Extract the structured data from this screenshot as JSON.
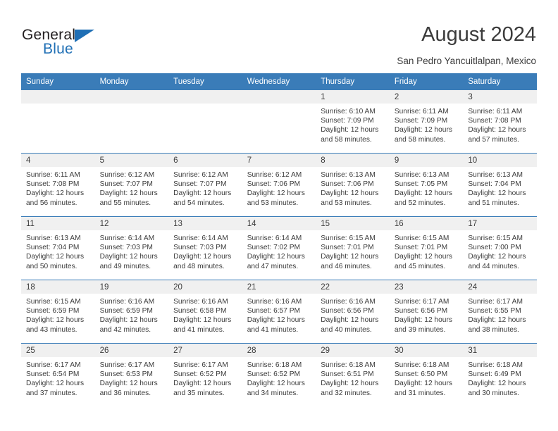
{
  "brand": {
    "word_one": "General",
    "word_two": "Blue",
    "logo_icon": "triangle-icon",
    "accent_color": "#1f6fb5"
  },
  "header": {
    "title": "August 2024",
    "subtitle": "San Pedro Yancuitlalpan, Mexico"
  },
  "theme": {
    "header_blue": "#3a7cb8",
    "daynum_gray": "#f0f0f0",
    "text": "#3b3b3b"
  },
  "calendar": {
    "weekday_headers": [
      "Sunday",
      "Monday",
      "Tuesday",
      "Wednesday",
      "Thursday",
      "Friday",
      "Saturday"
    ],
    "labels": {
      "sunrise": "Sunrise:",
      "sunset": "Sunset:",
      "daylight": "Daylight:"
    },
    "weeks": [
      [
        {
          "day": "",
          "blank": true
        },
        {
          "day": "",
          "blank": true
        },
        {
          "day": "",
          "blank": true
        },
        {
          "day": "",
          "blank": true
        },
        {
          "day": "1",
          "sunrise": "Sunrise: 6:10 AM",
          "sunset": "Sunset: 7:09 PM",
          "daylight": "Daylight: 12 hours and 58 minutes."
        },
        {
          "day": "2",
          "sunrise": "Sunrise: 6:11 AM",
          "sunset": "Sunset: 7:09 PM",
          "daylight": "Daylight: 12 hours and 58 minutes."
        },
        {
          "day": "3",
          "sunrise": "Sunrise: 6:11 AM",
          "sunset": "Sunset: 7:08 PM",
          "daylight": "Daylight: 12 hours and 57 minutes."
        }
      ],
      [
        {
          "day": "4",
          "sunrise": "Sunrise: 6:11 AM",
          "sunset": "Sunset: 7:08 PM",
          "daylight": "Daylight: 12 hours and 56 minutes."
        },
        {
          "day": "5",
          "sunrise": "Sunrise: 6:12 AM",
          "sunset": "Sunset: 7:07 PM",
          "daylight": "Daylight: 12 hours and 55 minutes."
        },
        {
          "day": "6",
          "sunrise": "Sunrise: 6:12 AM",
          "sunset": "Sunset: 7:07 PM",
          "daylight": "Daylight: 12 hours and 54 minutes."
        },
        {
          "day": "7",
          "sunrise": "Sunrise: 6:12 AM",
          "sunset": "Sunset: 7:06 PM",
          "daylight": "Daylight: 12 hours and 53 minutes."
        },
        {
          "day": "8",
          "sunrise": "Sunrise: 6:13 AM",
          "sunset": "Sunset: 7:06 PM",
          "daylight": "Daylight: 12 hours and 53 minutes."
        },
        {
          "day": "9",
          "sunrise": "Sunrise: 6:13 AM",
          "sunset": "Sunset: 7:05 PM",
          "daylight": "Daylight: 12 hours and 52 minutes."
        },
        {
          "day": "10",
          "sunrise": "Sunrise: 6:13 AM",
          "sunset": "Sunset: 7:04 PM",
          "daylight": "Daylight: 12 hours and 51 minutes."
        }
      ],
      [
        {
          "day": "11",
          "sunrise": "Sunrise: 6:13 AM",
          "sunset": "Sunset: 7:04 PM",
          "daylight": "Daylight: 12 hours and 50 minutes."
        },
        {
          "day": "12",
          "sunrise": "Sunrise: 6:14 AM",
          "sunset": "Sunset: 7:03 PM",
          "daylight": "Daylight: 12 hours and 49 minutes."
        },
        {
          "day": "13",
          "sunrise": "Sunrise: 6:14 AM",
          "sunset": "Sunset: 7:03 PM",
          "daylight": "Daylight: 12 hours and 48 minutes."
        },
        {
          "day": "14",
          "sunrise": "Sunrise: 6:14 AM",
          "sunset": "Sunset: 7:02 PM",
          "daylight": "Daylight: 12 hours and 47 minutes."
        },
        {
          "day": "15",
          "sunrise": "Sunrise: 6:15 AM",
          "sunset": "Sunset: 7:01 PM",
          "daylight": "Daylight: 12 hours and 46 minutes."
        },
        {
          "day": "16",
          "sunrise": "Sunrise: 6:15 AM",
          "sunset": "Sunset: 7:01 PM",
          "daylight": "Daylight: 12 hours and 45 minutes."
        },
        {
          "day": "17",
          "sunrise": "Sunrise: 6:15 AM",
          "sunset": "Sunset: 7:00 PM",
          "daylight": "Daylight: 12 hours and 44 minutes."
        }
      ],
      [
        {
          "day": "18",
          "sunrise": "Sunrise: 6:15 AM",
          "sunset": "Sunset: 6:59 PM",
          "daylight": "Daylight: 12 hours and 43 minutes."
        },
        {
          "day": "19",
          "sunrise": "Sunrise: 6:16 AM",
          "sunset": "Sunset: 6:59 PM",
          "daylight": "Daylight: 12 hours and 42 minutes."
        },
        {
          "day": "20",
          "sunrise": "Sunrise: 6:16 AM",
          "sunset": "Sunset: 6:58 PM",
          "daylight": "Daylight: 12 hours and 41 minutes."
        },
        {
          "day": "21",
          "sunrise": "Sunrise: 6:16 AM",
          "sunset": "Sunset: 6:57 PM",
          "daylight": "Daylight: 12 hours and 41 minutes."
        },
        {
          "day": "22",
          "sunrise": "Sunrise: 6:16 AM",
          "sunset": "Sunset: 6:56 PM",
          "daylight": "Daylight: 12 hours and 40 minutes."
        },
        {
          "day": "23",
          "sunrise": "Sunrise: 6:17 AM",
          "sunset": "Sunset: 6:56 PM",
          "daylight": "Daylight: 12 hours and 39 minutes."
        },
        {
          "day": "24",
          "sunrise": "Sunrise: 6:17 AM",
          "sunset": "Sunset: 6:55 PM",
          "daylight": "Daylight: 12 hours and 38 minutes."
        }
      ],
      [
        {
          "day": "25",
          "sunrise": "Sunrise: 6:17 AM",
          "sunset": "Sunset: 6:54 PM",
          "daylight": "Daylight: 12 hours and 37 minutes."
        },
        {
          "day": "26",
          "sunrise": "Sunrise: 6:17 AM",
          "sunset": "Sunset: 6:53 PM",
          "daylight": "Daylight: 12 hours and 36 minutes."
        },
        {
          "day": "27",
          "sunrise": "Sunrise: 6:17 AM",
          "sunset": "Sunset: 6:52 PM",
          "daylight": "Daylight: 12 hours and 35 minutes."
        },
        {
          "day": "28",
          "sunrise": "Sunrise: 6:18 AM",
          "sunset": "Sunset: 6:52 PM",
          "daylight": "Daylight: 12 hours and 34 minutes."
        },
        {
          "day": "29",
          "sunrise": "Sunrise: 6:18 AM",
          "sunset": "Sunset: 6:51 PM",
          "daylight": "Daylight: 12 hours and 32 minutes."
        },
        {
          "day": "30",
          "sunrise": "Sunrise: 6:18 AM",
          "sunset": "Sunset: 6:50 PM",
          "daylight": "Daylight: 12 hours and 31 minutes."
        },
        {
          "day": "31",
          "sunrise": "Sunrise: 6:18 AM",
          "sunset": "Sunset: 6:49 PM",
          "daylight": "Daylight: 12 hours and 30 minutes."
        }
      ]
    ]
  }
}
